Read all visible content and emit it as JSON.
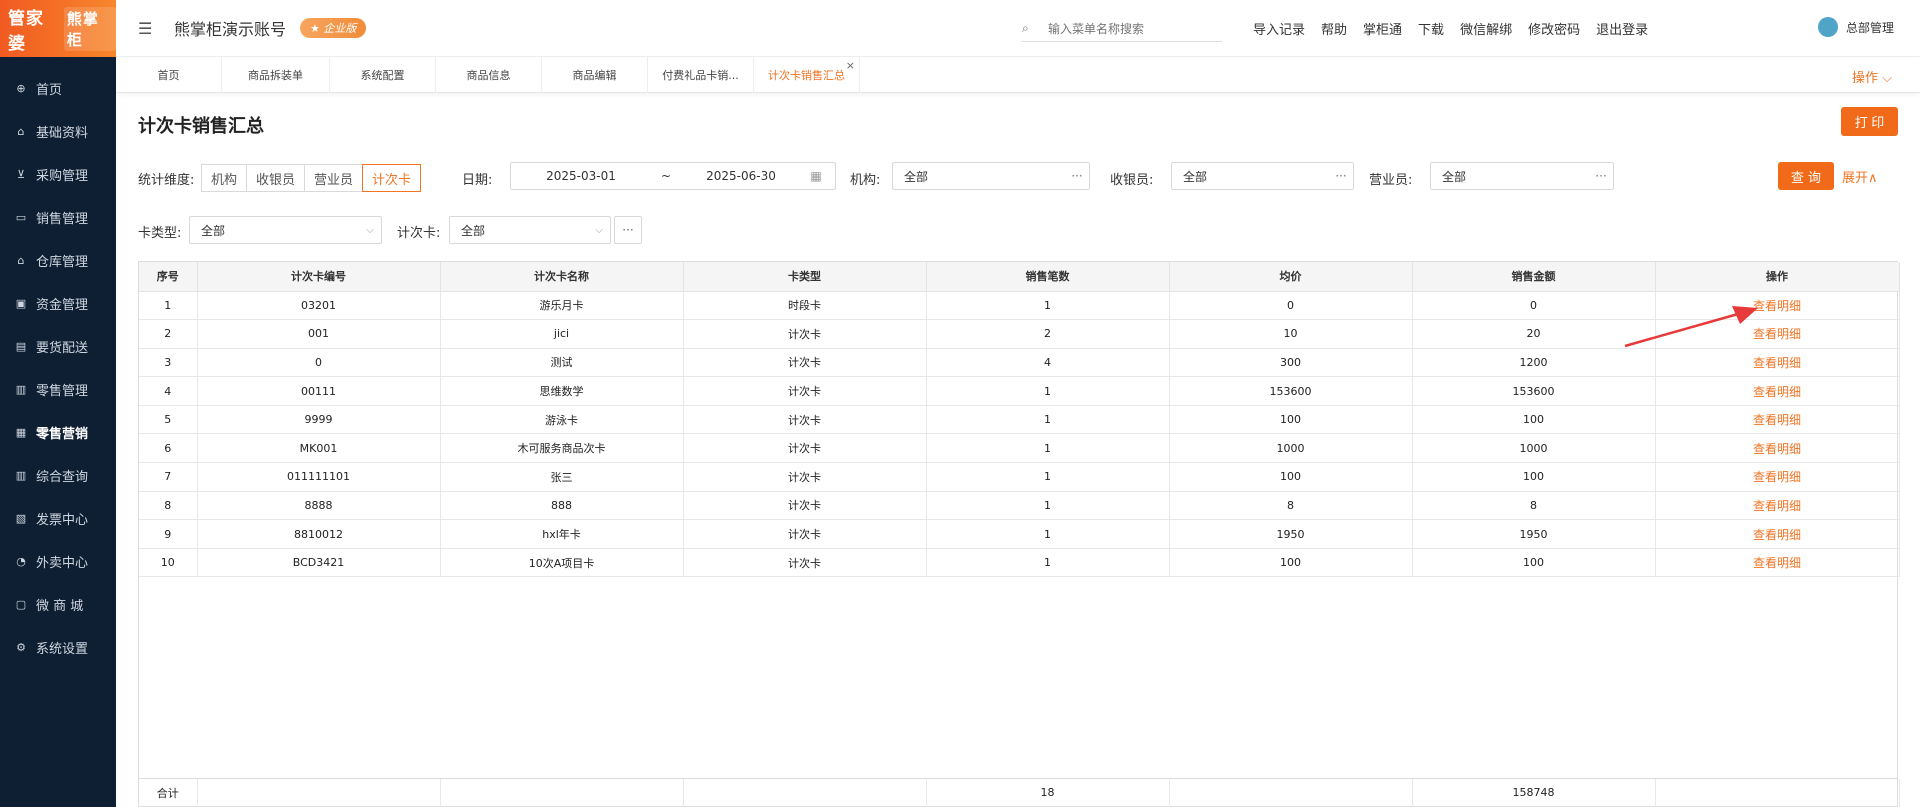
{
  "brand": {
    "logo": "管家婆",
    "logo_sub": "熊掌柜"
  },
  "sidebar": {
    "items": [
      {
        "label": "首页",
        "icon": "globe-icon"
      },
      {
        "label": "基础资料",
        "icon": "home-icon"
      },
      {
        "label": "采购管理",
        "icon": "cart-icon"
      },
      {
        "label": "销售管理",
        "icon": "sales-icon"
      },
      {
        "label": "仓库管理",
        "icon": "warehouse-icon"
      },
      {
        "label": "资金管理",
        "icon": "money-icon"
      },
      {
        "label": "要货配送",
        "icon": "delivery-icon"
      },
      {
        "label": "零售管理",
        "icon": "chart-icon"
      },
      {
        "label": "零售营销",
        "icon": "gift-icon"
      },
      {
        "label": "综合查询",
        "icon": "bar-chart-icon"
      },
      {
        "label": "发票中心",
        "icon": "invoice-icon"
      },
      {
        "label": "外卖中心",
        "icon": "takeout-icon"
      },
      {
        "label": "微 商 城",
        "icon": "shop-icon"
      },
      {
        "label": "系统设置",
        "icon": "gear-icon"
      }
    ]
  },
  "header": {
    "account": "熊掌柜演示账号",
    "badge": "企业版",
    "search_placeholder": "输入菜单名称搜索",
    "links": [
      "导入记录",
      "帮助",
      "掌柜通",
      "下载",
      "微信解绑",
      "修改密码",
      "退出登录"
    ],
    "user": "总部管理"
  },
  "tabs": [
    {
      "label": "首页"
    },
    {
      "label": "商品拆装单"
    },
    {
      "label": "系统配置"
    },
    {
      "label": "商品信息"
    },
    {
      "label": "商品编辑"
    },
    {
      "label": "付费礼品卡销..."
    },
    {
      "label": "计次卡销售汇总"
    }
  ],
  "ops_label": "操作 ⌵",
  "page": {
    "title": "计次卡销售汇总",
    "print_label": "打 印",
    "dim_label": "统计维度:",
    "dim_options": [
      "机构",
      "收银员",
      "营业员",
      "计次卡"
    ],
    "date_label": "日期:",
    "date_start": "2025-03-01",
    "date_sep": "~",
    "date_end": "2025-06-30",
    "org_label": "机构:",
    "org_value": "全部",
    "cashier_label": "收银员:",
    "cashier_value": "全部",
    "clerk_label": "营业员:",
    "clerk_value": "全部",
    "query_label": "查 询",
    "expand_label": "展开∧",
    "cardtype_label": "卡类型:",
    "cardtype_value": "全部",
    "card_label": "计次卡:",
    "card_value": "全部"
  },
  "table": {
    "headers": [
      "序号",
      "计次卡编号",
      "计次卡名称",
      "卡类型",
      "销售笔数",
      "均价",
      "销售金额",
      "操作"
    ],
    "rows": [
      [
        "1",
        "03201",
        "游乐月卡",
        "时段卡",
        "1",
        "0",
        "0",
        "查看明细"
      ],
      [
        "2",
        "001",
        "jici",
        "计次卡",
        "2",
        "10",
        "20",
        "查看明细"
      ],
      [
        "3",
        "0",
        "测试",
        "计次卡",
        "4",
        "300",
        "1200",
        "查看明细"
      ],
      [
        "4",
        "00111",
        "思维数学",
        "计次卡",
        "1",
        "153600",
        "153600",
        "查看明细"
      ],
      [
        "5",
        "9999",
        "游泳卡",
        "计次卡",
        "1",
        "100",
        "100",
        "查看明细"
      ],
      [
        "6",
        "MK001",
        "木可服务商品次卡",
        "计次卡",
        "1",
        "1000",
        "1000",
        "查看明细"
      ],
      [
        "7",
        "011111101",
        "张三",
        "计次卡",
        "1",
        "100",
        "100",
        "查看明细"
      ],
      [
        "8",
        "8888",
        "888",
        "计次卡",
        "1",
        "8",
        "8",
        "查看明细"
      ],
      [
        "9",
        "8810012",
        "hxl年卡",
        "计次卡",
        "1",
        "1950",
        "1950",
        "查看明细"
      ],
      [
        "10",
        "BCD3421",
        "10次A项目卡",
        "计次卡",
        "1",
        "100",
        "100",
        "查看明细"
      ]
    ],
    "footer": [
      "合计",
      "",
      "",
      "",
      "18",
      "",
      "158748",
      ""
    ]
  },
  "colors": {
    "accent": "#f07424",
    "sidebar_bg": "#0f1f33",
    "arrow": "#e8393a"
  }
}
